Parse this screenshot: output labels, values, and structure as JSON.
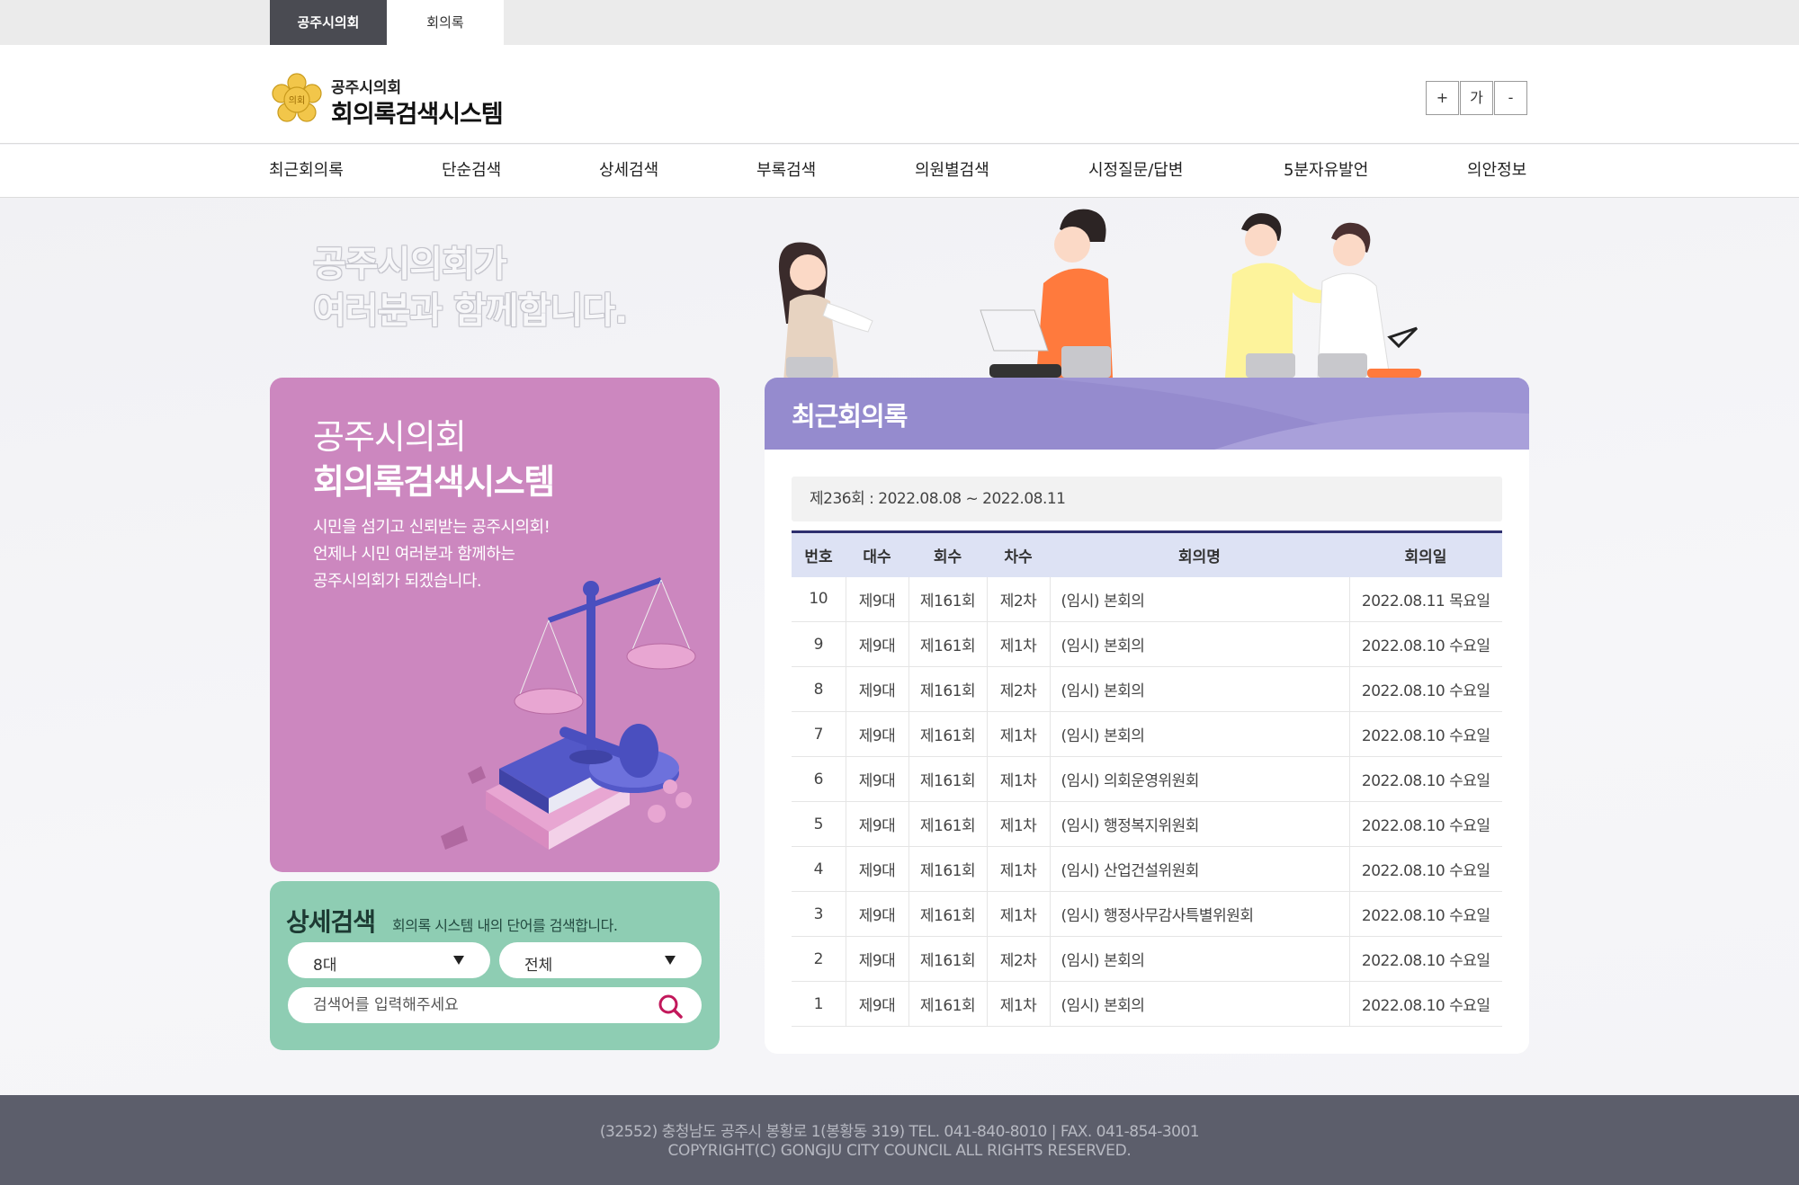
{
  "top_tabs": [
    "공주시의회",
    "회의록"
  ],
  "header": {
    "logo_sub": "공주시의회",
    "logo_main": "회의록검색시스템",
    "emblem_text": "의회",
    "font_controls": [
      "+",
      "가",
      "-"
    ]
  },
  "nav": {
    "items": [
      "최근회의록",
      "단순검색",
      "상세검색",
      "부록검색",
      "의원별검색",
      "시정질문/답변",
      "5분자유발언",
      "의안정보"
    ]
  },
  "hero": {
    "slogan_line1": "공주시의회가",
    "slogan_line2": "여러분과 함께합니다."
  },
  "intro": {
    "title1": "공주시의회",
    "title2": "회의록검색시스템",
    "text_line1": "시민을 섬기고 신뢰받는 공주시의회!",
    "text_line2": "언제나 시민 여러분과 함께하는",
    "text_line3": "공주시의회가 되겠습니다."
  },
  "search": {
    "title": "상세검색",
    "description": "회의록 시스템 내의 단어를 검색합니다.",
    "select_term": "8대",
    "select_type": "전체",
    "placeholder": "검색어를 입력해주세요"
  },
  "recent": {
    "title": "최근회의록",
    "session": "제236회 : 2022.08.08 ~ 2022.08.11",
    "columns": [
      "번호",
      "대수",
      "회수",
      "차수",
      "회의명",
      "회의일"
    ],
    "rows": [
      {
        "no": "10",
        "term": "제9대",
        "session": "제161회",
        "order": "제2차",
        "name": "(임시) 본회의",
        "date": "2022.08.11 목요일"
      },
      {
        "no": "9",
        "term": "제9대",
        "session": "제161회",
        "order": "제1차",
        "name": "(임시) 본회의",
        "date": "2022.08.10 수요일"
      },
      {
        "no": "8",
        "term": "제9대",
        "session": "제161회",
        "order": "제2차",
        "name": "(임시) 본회의",
        "date": "2022.08.10 수요일"
      },
      {
        "no": "7",
        "term": "제9대",
        "session": "제161회",
        "order": "제1차",
        "name": "(임시) 본회의",
        "date": "2022.08.10 수요일"
      },
      {
        "no": "6",
        "term": "제9대",
        "session": "제161회",
        "order": "제1차",
        "name": "(임시) 의회운영위원회",
        "date": "2022.08.10 수요일"
      },
      {
        "no": "5",
        "term": "제9대",
        "session": "제161회",
        "order": "제1차",
        "name": "(임시) 행정복지위원회",
        "date": "2022.08.10 수요일"
      },
      {
        "no": "4",
        "term": "제9대",
        "session": "제161회",
        "order": "제1차",
        "name": "(임시) 산업건설위원회",
        "date": "2022.08.10 수요일"
      },
      {
        "no": "3",
        "term": "제9대",
        "session": "제161회",
        "order": "제1차",
        "name": "(임시) 행정사무감사특별위원회",
        "date": "2022.08.10 수요일"
      },
      {
        "no": "2",
        "term": "제9대",
        "session": "제161회",
        "order": "제2차",
        "name": "(임시) 본회의",
        "date": "2022.08.10 수요일"
      },
      {
        "no": "1",
        "term": "제9대",
        "session": "제161회",
        "order": "제1차",
        "name": "(임시) 본회의",
        "date": "2022.08.10 수요일"
      }
    ]
  },
  "footer": {
    "address": "(32552) 충청남도 공주시 봉황로 1(봉황동 319) TEL. 041-840-8010 | FAX. 041-854-3001",
    "copyright": "COPYRIGHT(C) GONGJU CITY COUNCIL ALL RIGHTS RESERVED."
  },
  "colors": {
    "top_tab_active": "#4a4b52",
    "intro_card": "#cc87bf",
    "search_card": "#8ecdb3",
    "panel_header": "#958bce",
    "table_header": "#dde2f4",
    "table_top_border": "#2d2f6e",
    "search_icon": "#c2185b",
    "footer": "#5c5e6b"
  },
  "icons": [
    "council-emblem-icon",
    "caret-down-icon",
    "search-icon"
  ]
}
